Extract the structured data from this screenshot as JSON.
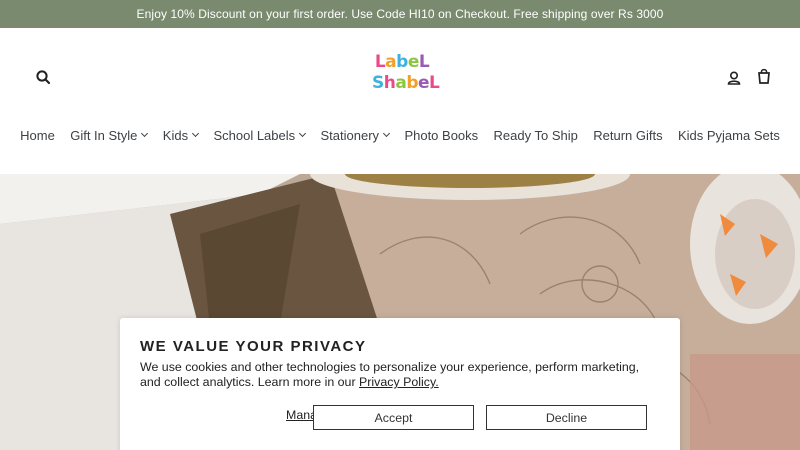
{
  "announcement": "Enjoy 10% Discount on your first order. Use Code HI10 on Checkout. Free shipping over Rs 3000",
  "logo": {
    "line1": "LabeL",
    "line2": "ShabeL"
  },
  "icons": {
    "search": "search-icon",
    "account": "user-icon",
    "cart": "cart-icon"
  },
  "nav": [
    {
      "label": "Home"
    },
    {
      "label": "Gift In Style"
    },
    {
      "label": "Kids"
    },
    {
      "label": "School Labels"
    },
    {
      "label": "Stationery"
    },
    {
      "label": "Photo Books"
    },
    {
      "label": "Ready To Ship"
    },
    {
      "label": "Return Gifts"
    },
    {
      "label": "Kids Pyjama Sets"
    }
  ],
  "privacy": {
    "title": "WE VALUE YOUR PRIVACY",
    "body": "We use cookies and other technologies to personalize your experience, perform marketing, and collect analytics. Learn more in our",
    "link": "Privacy Policy.",
    "manage": "Manage preferences",
    "accept": "Accept",
    "decline": "Decline"
  },
  "colors": {
    "announcement_bg": "#7a8a6e",
    "text": "#3d4246"
  }
}
